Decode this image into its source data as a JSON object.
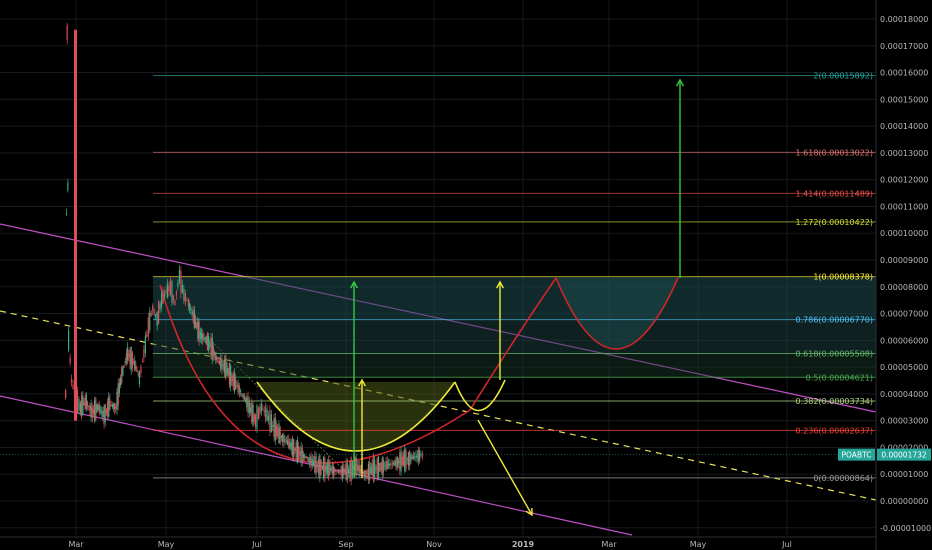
{
  "chart_data": {
    "type": "line",
    "ticker_label": "POABTC",
    "current_price_label": "0.00001732",
    "current_price": 1.732e-05,
    "y_axis": {
      "range": [
        -1.2e-06,
        1.86e-05
      ],
      "tick_labels": [
        "0.00018000",
        "0.00017000",
        "0.00016000",
        "0.00015000",
        "0.00014000",
        "0.00013000",
        "0.00012000",
        "0.00011000",
        "0.00010000",
        "0.00009000",
        "0.00008000",
        "0.00007000",
        "0.00006000",
        "0.00005000",
        "0.00004000",
        "0.00003000",
        "0.00002000",
        "0.00001000",
        "0.00000000",
        "-0.00001000"
      ]
    },
    "x_axis": {
      "tick_labels": [
        "Mar",
        "May",
        "Jul",
        "Sep",
        "Nov",
        "2019",
        "Mar",
        "May",
        "Jul"
      ],
      "start": "2018-02-01",
      "end": "2019-08-01"
    },
    "fibonacci_levels": [
      {
        "label": "2(0.00015892)",
        "value": 0.00015892,
        "color": "#26a69a"
      },
      {
        "label": "1.618(0.00013022)",
        "value": 0.00013022,
        "color": "#e57373"
      },
      {
        "label": "1.414(0.00011489)",
        "value": 0.00011489,
        "color": "#ef5350"
      },
      {
        "label": "1.272(0.00010422)",
        "value": 0.00010422,
        "color": "#cddc39"
      },
      {
        "label": "1(0.00008378)",
        "value": 8.378e-05,
        "color": "#ffeb3b"
      },
      {
        "label": "0.786(0.00006770)",
        "value": 6.77e-05,
        "color": "#4fc3f7"
      },
      {
        "label": "0.618(0.00005508)",
        "value": 5.508e-05,
        "color": "#66bb6a"
      },
      {
        "label": "0.5(0.00004621)",
        "value": 4.621e-05,
        "color": "#4caf50"
      },
      {
        "label": "0.382(0.00003734)",
        "value": 3.734e-05,
        "color": "#aed581"
      },
      {
        "label": "0.236(0.00002637)",
        "value": 2.637e-05,
        "color": "#f44336"
      },
      {
        "label": "0(0.00000864)",
        "value": 8.64e-06,
        "color": "#9e9e9e"
      }
    ],
    "price_series": [
      {
        "date": "2018-02-22",
        "value": 4e-05
      },
      {
        "date": "2018-02-23",
        "value": 0.000175
      },
      {
        "date": "2018-02-24",
        "value": 6e-05
      },
      {
        "date": "2018-02-26",
        "value": 4.5e-05
      },
      {
        "date": "2018-03-01",
        "value": 3.8e-05
      },
      {
        "date": "2018-03-04",
        "value": 3.5e-05
      },
      {
        "date": "2018-03-08",
        "value": 3.7e-05
      },
      {
        "date": "2018-03-12",
        "value": 3.3e-05
      },
      {
        "date": "2018-03-16",
        "value": 3.5e-05
      },
      {
        "date": "2018-03-20",
        "value": 3.2e-05
      },
      {
        "date": "2018-03-24",
        "value": 3.6e-05
      },
      {
        "date": "2018-03-28",
        "value": 3.5e-05
      },
      {
        "date": "2018-04-01",
        "value": 4.7e-05
      },
      {
        "date": "2018-04-05",
        "value": 5.5e-05
      },
      {
        "date": "2018-04-09",
        "value": 5.2e-05
      },
      {
        "date": "2018-04-13",
        "value": 4.6e-05
      },
      {
        "date": "2018-04-16",
        "value": 5.5e-05
      },
      {
        "date": "2018-04-19",
        "value": 6.5e-05
      },
      {
        "date": "2018-04-22",
        "value": 7.2e-05
      },
      {
        "date": "2018-04-25",
        "value": 6.8e-05
      },
      {
        "date": "2018-04-28",
        "value": 7.5e-05
      },
      {
        "date": "2018-05-01",
        "value": 7.8e-05
      },
      {
        "date": "2018-05-04",
        "value": 8e-05
      },
      {
        "date": "2018-05-07",
        "value": 7.4e-05
      },
      {
        "date": "2018-05-10",
        "value": 8.4e-05
      },
      {
        "date": "2018-05-13",
        "value": 7.7e-05
      },
      {
        "date": "2018-05-16",
        "value": 7.4e-05
      },
      {
        "date": "2018-05-20",
        "value": 6.8e-05
      },
      {
        "date": "2018-05-24",
        "value": 6.2e-05
      },
      {
        "date": "2018-05-28",
        "value": 6e-05
      },
      {
        "date": "2018-06-01",
        "value": 5.7e-05
      },
      {
        "date": "2018-06-05",
        "value": 5.2e-05
      },
      {
        "date": "2018-06-10",
        "value": 5e-05
      },
      {
        "date": "2018-06-15",
        "value": 4.5e-05
      },
      {
        "date": "2018-06-20",
        "value": 4.1e-05
      },
      {
        "date": "2018-06-25",
        "value": 3.6e-05
      },
      {
        "date": "2018-06-30",
        "value": 3e-05
      },
      {
        "date": "2018-07-04",
        "value": 3.5e-05
      },
      {
        "date": "2018-07-08",
        "value": 3.2e-05
      },
      {
        "date": "2018-07-12",
        "value": 2.8e-05
      },
      {
        "date": "2018-07-18",
        "value": 2.4e-05
      },
      {
        "date": "2018-07-24",
        "value": 2.1e-05
      },
      {
        "date": "2018-07-30",
        "value": 1.8e-05
      },
      {
        "date": "2018-08-05",
        "value": 1.6e-05
      },
      {
        "date": "2018-08-12",
        "value": 1.3e-05
      },
      {
        "date": "2018-08-19",
        "value": 1.2e-05
      },
      {
        "date": "2018-08-26",
        "value": 1.1e-05
      },
      {
        "date": "2018-09-02",
        "value": 1.1e-05
      },
      {
        "date": "2018-09-08",
        "value": 1.3e-05
      },
      {
        "date": "2018-09-14",
        "value": 1e-05
      },
      {
        "date": "2018-09-20",
        "value": 1.2e-05
      },
      {
        "date": "2018-09-27",
        "value": 1.3e-05
      },
      {
        "date": "2018-10-04",
        "value": 1.4e-05
      },
      {
        "date": "2018-10-10",
        "value": 1.5e-05
      },
      {
        "date": "2018-10-16",
        "value": 1.6e-05
      },
      {
        "date": "2018-10-22",
        "value": 1.7e-05
      },
      {
        "date": "2018-10-25",
        "value": 1.73e-05
      }
    ]
  }
}
